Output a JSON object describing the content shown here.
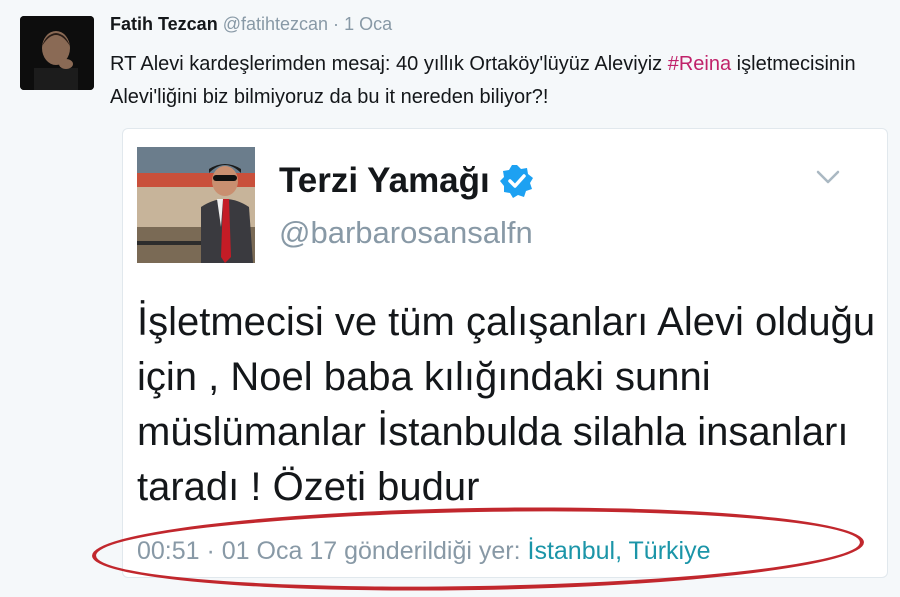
{
  "outer_tweet": {
    "name": "Fatih Tezcan",
    "handle": "@fatihtezcan",
    "separator": "·",
    "date": "1 Oca",
    "text_before_hashtag": "RT Alevi kardeşlerimden mesaj: 40 yıllık Ortaköy'lüyüz Aleviyiz ",
    "hashtag": "#Reina",
    "text_after_hashtag": " işletmecisinin Alevi'liğini biz bilmiyoruz da bu it nereden biliyor?!"
  },
  "quoted_tweet": {
    "name": "Terzi Yamağı",
    "handle": "@barbarosansalfn",
    "text": "İşletmecisi ve tüm çalışanları Alevi olduğu için , Noel baba kılığındaki sunni müslümanlar İstanbulda silahla insanları taradı ! Özeti budur",
    "meta_prefix": "00:51 · 01 Oca 17 gönderildiği yer: ",
    "location": "İstanbul, Türkiye"
  },
  "colors": {
    "hashtag": "#c0226a",
    "verified": "#1da1f2",
    "annotation_oval": "#c1272d",
    "location_link": "#1b95a8"
  },
  "icons": {
    "verified": "verified-badge-icon",
    "menu": "chevron-down-icon"
  }
}
